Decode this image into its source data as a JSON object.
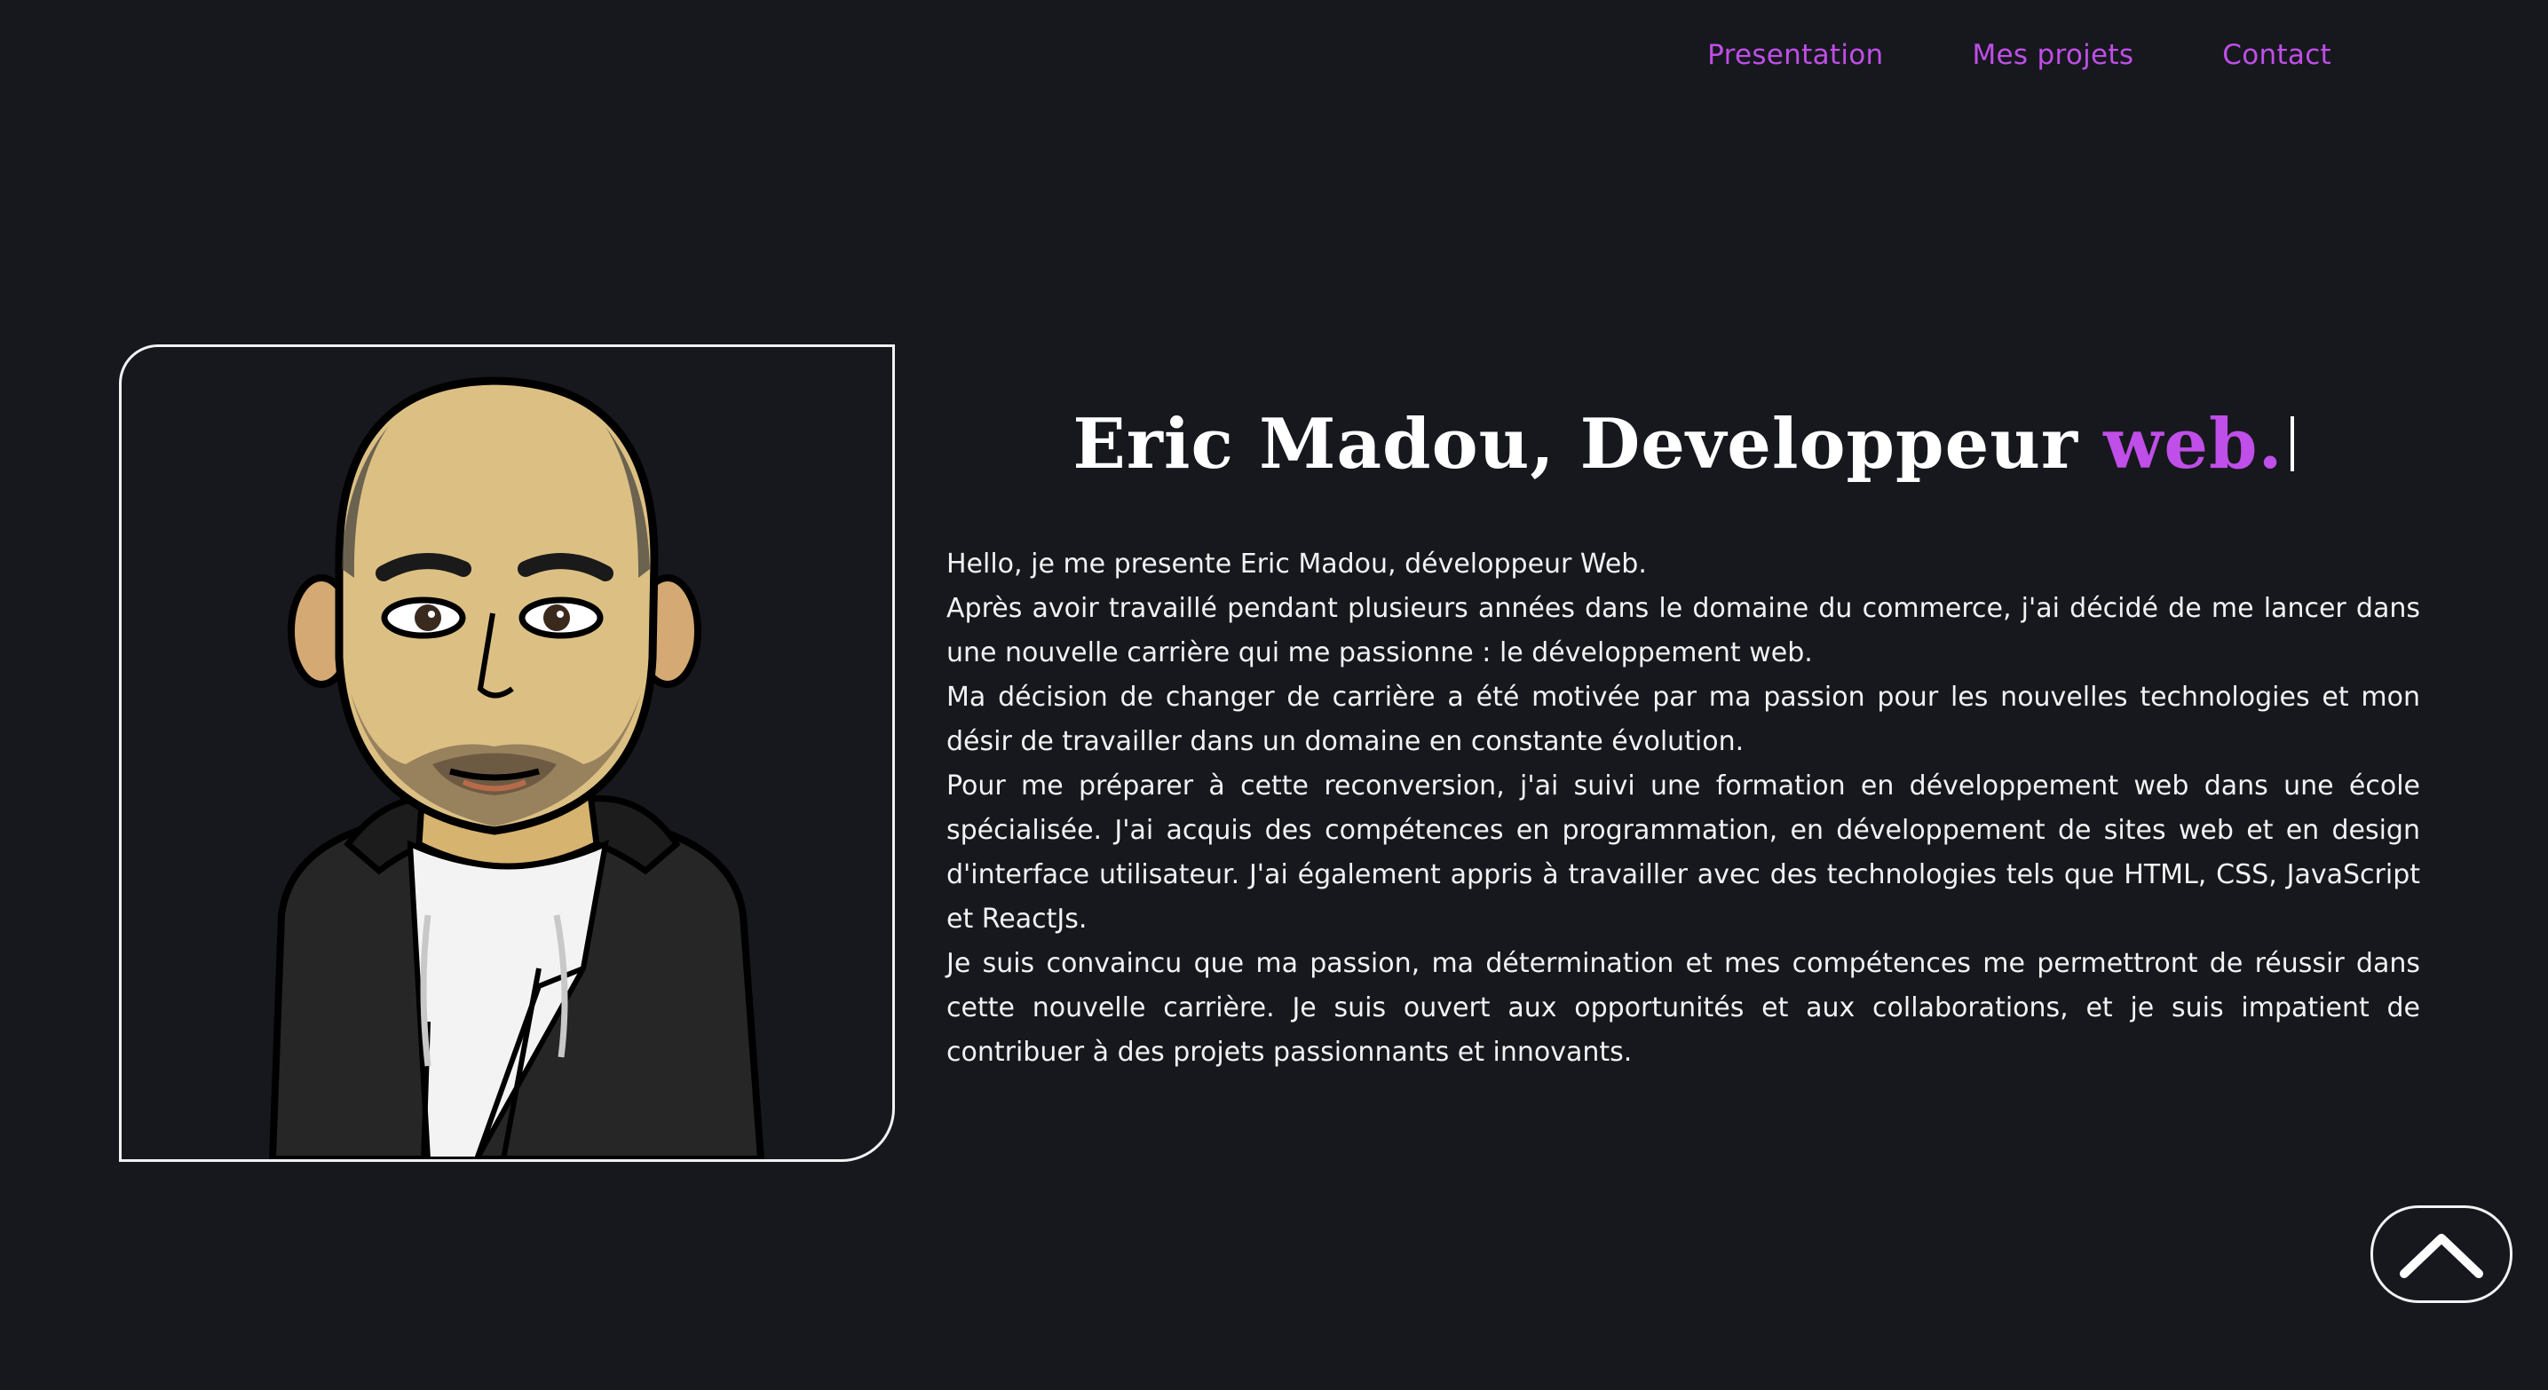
{
  "nav": {
    "items": [
      {
        "label": "Presentation"
      },
      {
        "label": "Mes projets"
      },
      {
        "label": "Contact"
      }
    ]
  },
  "hero": {
    "title_main": "Eric Madou, Developpeur ",
    "title_accent": "web."
  },
  "bio": {
    "paragraphs": [
      "Hello, je me presente Eric Madou, développeur Web.",
      "Après avoir travaillé pendant plusieurs années dans le domaine du commerce, j'ai décidé de me lancer dans une nouvelle carrière qui me passionne : le développement web.",
      "Ma décision de changer de carrière a été motivée par ma passion pour les nouvelles technologies et mon désir de travailler dans un domaine en constante évolution.",
      "Pour me préparer à cette reconversion, j'ai suivi une formation en développement web dans une école spécialisée. J'ai acquis des compétences en programmation, en développement de sites web et en design d'interface utilisateur. J'ai également appris à travailler avec des technologies tels que HTML, CSS, JavaScript et ReactJs.",
      "Je suis convaincu que ma passion, ma détermination et mes compétences me permettront de réussir dans cette nouvelle carrière. Je suis ouvert aux opportunités et aux collaborations, et je suis impatient de contribuer à des projets passionnants et innovants."
    ]
  },
  "icons": {
    "scroll_top": "chevron-up-icon",
    "avatar": "cartoon-avatar"
  },
  "colors": {
    "background": "#16181d",
    "accent": "#c04ee8",
    "text": "#ffffff",
    "border": "#f2f2f2"
  }
}
